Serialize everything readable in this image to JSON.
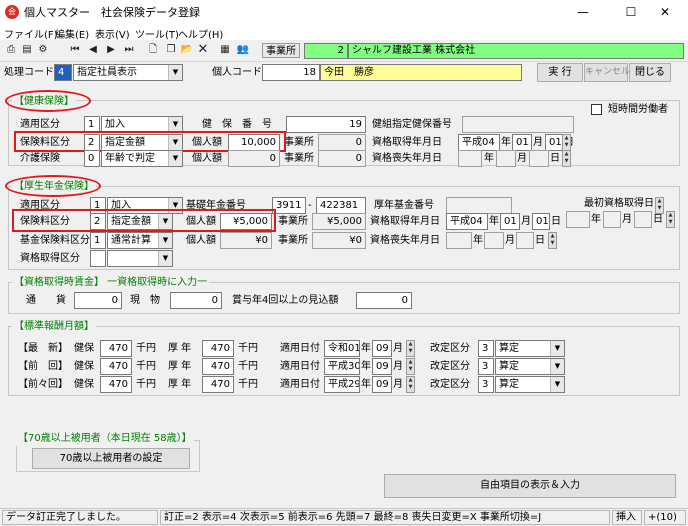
{
  "window": {
    "title": "個人マスター　社会保険データ登録",
    "icon_glyph": "会",
    "minimize": "—",
    "maximize": "☐",
    "close": "✕"
  },
  "menu": [
    "ファイル(F)",
    "編集(E)",
    "表示(V)",
    "ツール(T)",
    "ヘルプ(H)"
  ],
  "toolbar": {
    "office_label": "事業所",
    "office_code": "2",
    "office_name": "シャルフ建設工業 株式会社"
  },
  "header": {
    "process_code_label": "処理コード",
    "process_code": "4",
    "process_mode": "指定社員表示",
    "personal_code_label": "個人コード",
    "personal_code": "18",
    "personal_name": "今田　勝彦",
    "execute": "実 行",
    "cancel": "キャンセル",
    "close": "閉じる"
  },
  "kenpo": {
    "title": "【健康保険】",
    "short_time_label": "短時間労働者",
    "apply_label": "適用区分",
    "apply_code": "1",
    "apply_value": "加入",
    "number_label": "健　保　番　号",
    "number_value": "19",
    "union_label": "健組指定健保番号",
    "union_value": "",
    "rate_label": "保険料区分",
    "rate_code": "2",
    "rate_value": "指定金額",
    "personal_amount_label": "個人額",
    "personal_amount": "10,000",
    "office_label": "事業所",
    "office_amount": "0",
    "acquire_label": "資格取得年月日",
    "acquire_era": "平成04",
    "acquire_year_unit": "年",
    "acquire_month": "01",
    "acquire_month_unit": "月",
    "acquire_day": "01",
    "acquire_day_unit": "日",
    "care_label": "介護保険",
    "care_code": "0",
    "care_value": "年齢で判定",
    "care_personal_label": "個人額",
    "care_personal": "0",
    "care_office_label": "事業所",
    "care_office": "0",
    "loss_label": "資格喪失年月日",
    "loss_year_unit": "年",
    "loss_month_unit": "月",
    "loss_day_unit": "日"
  },
  "kosei": {
    "title": "【厚生年金保険】",
    "apply_label": "適用区分",
    "apply_code": "1",
    "apply_value": "加入",
    "basic_label": "基礎年金番号",
    "basic_a": "3911",
    "basic_sep": "-",
    "basic_b": "422381",
    "fund_label": "厚年基金番号",
    "fund_value": "",
    "first_label": "最初資格取得日",
    "first_year_unit": "年",
    "first_month_unit": "月",
    "first_day_unit": "日",
    "rate_label": "保険料区分",
    "rate_code": "2",
    "rate_value": "指定金額",
    "personal_label": "個人額",
    "personal_amount": "¥5,000",
    "office_label": "事業所",
    "office_amount": "¥5,000",
    "acquire_label": "資格取得年月日",
    "acquire_era": "平成04",
    "acquire_year_unit": "年",
    "acquire_month": "01",
    "acquire_month_unit": "月",
    "acquire_day": "01",
    "acquire_day_unit": "日",
    "fund_rate_label": "基金保険料区分",
    "fund_code": "1",
    "fund_value2": "通常計算",
    "fund_personal_label": "個人額",
    "fund_personal": "¥0",
    "fund_office_label": "事業所",
    "fund_office": "¥0",
    "loss_label": "資格喪失年月日",
    "loss_year_unit": "年",
    "loss_month_unit": "月",
    "loss_day_unit": "日",
    "acq_kind_label": "資格取得区分"
  },
  "wage": {
    "title": "【資格取得時賃金】 一資格取得時に入力一",
    "currency_label": "通　　貨",
    "currency": "0",
    "kind_label": "現　物",
    "kind": "0",
    "bonus_label": "賞与年4回以上の見込額",
    "bonus": "0"
  },
  "standard": {
    "title": "【標準報酬月額】",
    "rows": [
      {
        "label": "【最　新】",
        "kenpo_label": "健保",
        "kenpo": "470",
        "unit": "千円",
        "kosei_label": "厚 年",
        "kosei": "470",
        "date_label": "適用日付",
        "date": "令和01",
        "year_unit": "年",
        "month": "09",
        "month_unit": "月",
        "revision_label": "改定区分",
        "rev_code": "3",
        "rev_value": "算定"
      },
      {
        "label": "【前　回】",
        "kenpo_label": "健保",
        "kenpo": "470",
        "unit": "千円",
        "kosei_label": "厚 年",
        "kosei": "470",
        "date_label": "適用日付",
        "date": "平成30",
        "year_unit": "年",
        "month": "09",
        "month_unit": "月",
        "revision_label": "改定区分",
        "rev_code": "3",
        "rev_value": "算定"
      },
      {
        "label": "【前々回】",
        "kenpo_label": "健保",
        "kenpo": "470",
        "unit": "千円",
        "kosei_label": "厚 年",
        "kosei": "470",
        "date_label": "適用日付",
        "date": "平成29",
        "year_unit": "年",
        "month": "09",
        "month_unit": "月",
        "revision_label": "改定区分",
        "rev_code": "3",
        "rev_value": "算定"
      }
    ]
  },
  "elder": {
    "title": "【70歳以上被用者（本日現在 58歳）】",
    "button": "70歳以上被用者の設定"
  },
  "free_button": "自由項目の表示＆入力",
  "status": {
    "message": "データ訂正完了しました。",
    "keys": "訂正=2 表示=4 次表示=5 前表示=6 先頭=7 最終=8 喪失日変更=X 事業所切換=J",
    "mode": "挿入",
    "code": "+(10)"
  },
  "colors": {
    "highlight_red": "#e01a1a",
    "group_green": "#008000",
    "office_green": "#80ff80",
    "name_yellow": "#ffff99"
  }
}
